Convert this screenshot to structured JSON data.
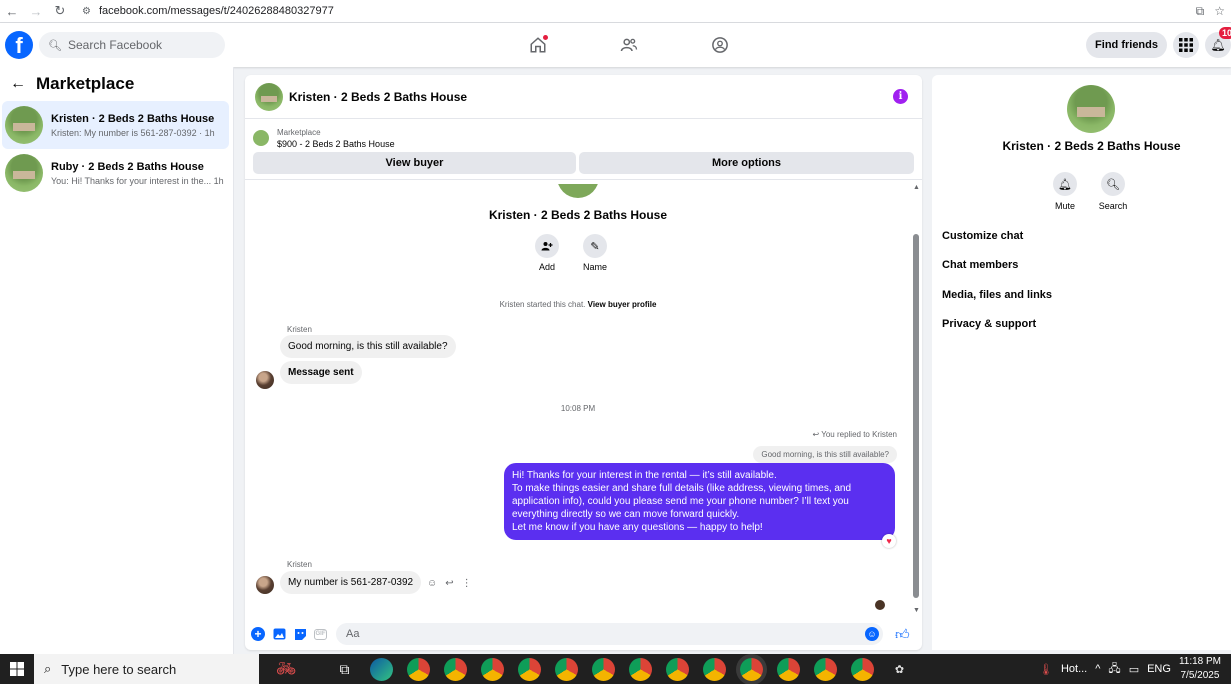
{
  "browser": {
    "url": "facebook.com/messages/t/24026288480327977"
  },
  "fb_nav": {
    "logo_letter": "f",
    "search_placeholder": "Search Facebook",
    "find_friends": "Find friends",
    "notifications_count": "10"
  },
  "sidebar": {
    "title": "Marketplace",
    "conversations": [
      {
        "name": "Kristen · 2 Beds 2 Baths House",
        "snippet": "Kristen: My number is 561-287-0392 · 1h"
      },
      {
        "name": "Ruby · 2 Beds 2 Baths House",
        "snippet": "You: Hi! Thanks for your interest in the... 1h"
      }
    ]
  },
  "chat": {
    "title": "Kristen · 2 Beds 2 Baths House",
    "marketplace_label": "Marketplace",
    "listing": "$900 - 2 Beds 2 Baths House",
    "view_buyer": "View buyer",
    "more_options": "More options",
    "center_name": "Kristen · 2 Beds 2 Baths House",
    "add_label": "Add",
    "name_label": "Name",
    "started_text": "Kristen started this chat.",
    "view_buyer_profile": "View buyer profile",
    "sender1": "Kristen",
    "msg1": "Good morning, is this still available?",
    "msg2": "Message sent",
    "time_divider": "10:08 PM",
    "replied_to": "You replied to Kristen",
    "quoted": "Good morning, is this still available?",
    "reply_lines": [
      "Hi! Thanks for your interest in the rental — it’s still available.",
      "To make things easier and share full details (like address, viewing times, and",
      "application info), could you please send me your phone number? I’ll text you",
      "everything directly so we can move forward quickly.",
      "Let me know if you have any questions — happy to help!"
    ],
    "sender2": "Kristen",
    "msg3": "My number is 561-287-0392",
    "composer_placeholder": "Aa"
  },
  "info_panel": {
    "name": "Kristen · 2 Beds 2 Baths House",
    "mute": "Mute",
    "search": "Search",
    "menu": [
      "Customize chat",
      "Chat members",
      "Media, files and links",
      "Privacy & support"
    ]
  },
  "taskbar": {
    "search_placeholder": "Type here to search",
    "weather": "Hot...",
    "lang": "ENG",
    "time": "11:18 PM",
    "date": "7/5/2025"
  },
  "colors": {
    "brand": "#0866ff",
    "outgoing_bubble": "#5b2ff0",
    "active_conv": "#e7f0ff",
    "info_icon": "#a020f0"
  }
}
